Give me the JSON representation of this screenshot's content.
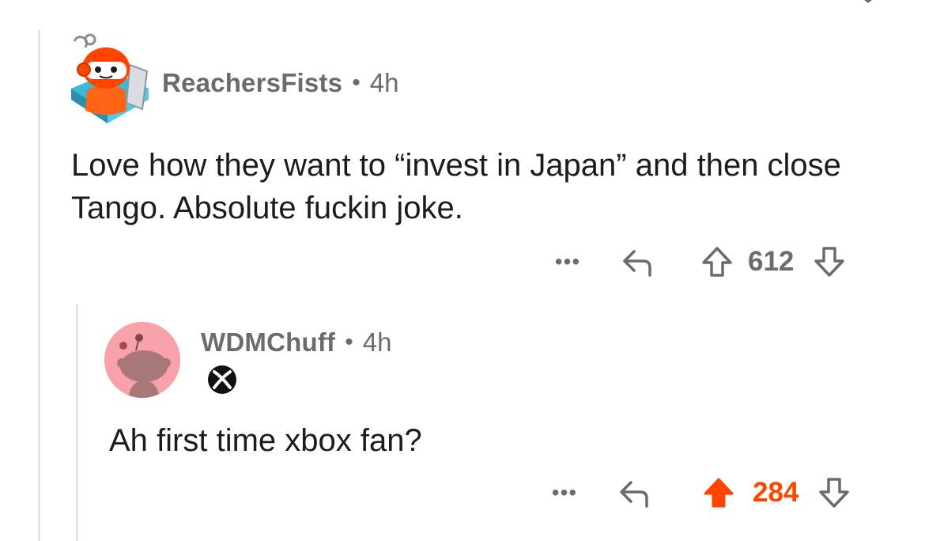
{
  "colors": {
    "upvote_active": "#ff4500",
    "muted": "#6b6b6b",
    "thread_line": "#e4e4e4",
    "avatar2_bg": "#f8a1a9"
  },
  "comments": [
    {
      "username": "ReachersFists",
      "separator": "•",
      "time": "4h",
      "body": "Love how they want to “invest in Japan” and then close Tango. Absolute fuckin joke.",
      "more": "•••",
      "score": "612",
      "vote_state": "none",
      "icons": {
        "avatar": "snoo-avatar-icon",
        "reply": "reply-icon",
        "upvote": "upvote-icon",
        "downvote": "downvote-icon"
      }
    },
    {
      "username": "WDMChuff",
      "separator": "•",
      "time": "4h",
      "flair_icon": "xbox-logo-icon",
      "body": "Ah first time xbox fan?",
      "more": "•••",
      "score": "284",
      "vote_state": "upvoted",
      "icons": {
        "avatar": "default-snoo-avatar-icon",
        "reply": "reply-icon",
        "upvote": "upvote-filled-icon",
        "downvote": "downvote-icon"
      }
    }
  ]
}
